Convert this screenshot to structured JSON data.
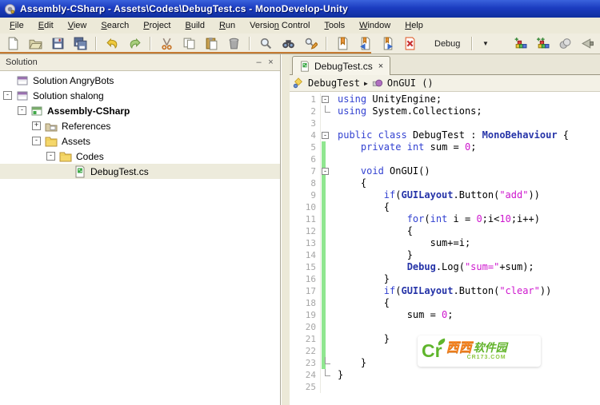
{
  "window": {
    "title": "Assembly-CSharp - Assets\\Codes\\DebugTest.cs - MonoDevelop-Unity"
  },
  "menu": {
    "items": [
      {
        "label": "File",
        "u": 0
      },
      {
        "label": "Edit",
        "u": 0
      },
      {
        "label": "View",
        "u": 0
      },
      {
        "label": "Search",
        "u": 0
      },
      {
        "label": "Project",
        "u": 0
      },
      {
        "label": "Build",
        "u": 0
      },
      {
        "label": "Run",
        "u": 0
      },
      {
        "label": "Version Control",
        "u": 6
      },
      {
        "label": "Tools",
        "u": 0
      },
      {
        "label": "Window",
        "u": 0
      },
      {
        "label": "Help",
        "u": 0
      }
    ]
  },
  "toolbar": {
    "debug_config": "Debug",
    "dropdown_glyph": "▼",
    "icons": [
      "new-file",
      "open",
      "save",
      "save-all",
      "undo",
      "redo",
      "cut",
      "copy",
      "paste",
      "delete",
      "search",
      "find-in-files",
      "search-replace",
      "toggle-bookmark",
      "previous-bookmark",
      "next-bookmark",
      "clear-bookmarks",
      "debug-config-dropdown",
      "unit-tests",
      "add-unit-tests",
      "attach-process",
      "filter"
    ]
  },
  "solution_pad": {
    "title": "Solution",
    "buttons": {
      "minimize": "‒",
      "close": "×"
    },
    "tree": [
      {
        "label": "Solution AngryBots",
        "level": 0,
        "expander": "none",
        "icon": "solution",
        "bold": false,
        "selected": false
      },
      {
        "label": "Solution shalong",
        "level": 0,
        "expander": "minus",
        "icon": "solution",
        "bold": false,
        "selected": false
      },
      {
        "label": "Assembly-CSharp",
        "level": 1,
        "expander": "minus",
        "icon": "project",
        "bold": true,
        "selected": false
      },
      {
        "label": "References",
        "level": 2,
        "expander": "plus",
        "icon": "references",
        "bold": false,
        "selected": false
      },
      {
        "label": "Assets",
        "level": 2,
        "expander": "minus",
        "icon": "folder",
        "bold": false,
        "selected": false
      },
      {
        "label": "Codes",
        "level": 3,
        "expander": "minus",
        "icon": "folder",
        "bold": false,
        "selected": false
      },
      {
        "label": "DebugTest.cs",
        "level": 4,
        "expander": "none",
        "icon": "csfile",
        "bold": false,
        "selected": true
      }
    ]
  },
  "editor": {
    "tab": {
      "label": "DebugTest.cs",
      "close_glyph": "×"
    },
    "breadcrumb": {
      "class_name": "DebugTest",
      "separator": "▶",
      "method": "OnGUI ()"
    },
    "code": {
      "lines": [
        {
          "n": "1",
          "fold": "start",
          "chg": false,
          "segs": [
            [
              "kw",
              "using"
            ],
            [
              "pl",
              " UnityEngine;"
            ]
          ]
        },
        {
          "n": "2",
          "fold": "end",
          "chg": false,
          "segs": [
            [
              "kw",
              "using"
            ],
            [
              "pl",
              " System.Collections;"
            ]
          ]
        },
        {
          "n": "3",
          "fold": "none",
          "chg": false,
          "segs": []
        },
        {
          "n": "4",
          "fold": "start",
          "chg": false,
          "segs": [
            [
              "kw",
              "public"
            ],
            [
              "pl",
              " "
            ],
            [
              "kw",
              "class"
            ],
            [
              "pl",
              " DebugTest : "
            ],
            [
              "ty",
              "MonoBehaviour"
            ],
            [
              "pl",
              " {"
            ]
          ]
        },
        {
          "n": "5",
          "fold": "none",
          "chg": true,
          "segs": [
            [
              "pl",
              "    "
            ],
            [
              "kw",
              "private"
            ],
            [
              "pl",
              " "
            ],
            [
              "kw",
              "int"
            ],
            [
              "pl",
              " sum = "
            ],
            [
              "nu",
              "0"
            ],
            [
              "pl",
              ";"
            ]
          ]
        },
        {
          "n": "6",
          "fold": "none",
          "chg": true,
          "segs": []
        },
        {
          "n": "7",
          "fold": "start",
          "chg": true,
          "segs": [
            [
              "pl",
              "    "
            ],
            [
              "kw",
              "void"
            ],
            [
              "pl",
              " OnGUI()"
            ]
          ]
        },
        {
          "n": "8",
          "fold": "none",
          "chg": true,
          "segs": [
            [
              "pl",
              "    {"
            ]
          ]
        },
        {
          "n": "9",
          "fold": "none",
          "chg": true,
          "segs": [
            [
              "pl",
              "        "
            ],
            [
              "kw",
              "if"
            ],
            [
              "pl",
              "("
            ],
            [
              "ty",
              "GUILayout"
            ],
            [
              "pl",
              ".Button("
            ],
            [
              "st",
              "\"add\""
            ],
            [
              "pl",
              "))"
            ]
          ]
        },
        {
          "n": "10",
          "fold": "none",
          "chg": true,
          "segs": [
            [
              "pl",
              "        {"
            ]
          ]
        },
        {
          "n": "11",
          "fold": "none",
          "chg": true,
          "segs": [
            [
              "pl",
              "            "
            ],
            [
              "kw",
              "for"
            ],
            [
              "pl",
              "("
            ],
            [
              "kw",
              "int"
            ],
            [
              "pl",
              " i = "
            ],
            [
              "nu",
              "0"
            ],
            [
              "pl",
              ";i<"
            ],
            [
              "nu",
              "10"
            ],
            [
              "pl",
              ";i++)"
            ]
          ]
        },
        {
          "n": "12",
          "fold": "none",
          "chg": true,
          "segs": [
            [
              "pl",
              "            {"
            ]
          ]
        },
        {
          "n": "13",
          "fold": "none",
          "chg": true,
          "segs": [
            [
              "pl",
              "                sum+=i;"
            ]
          ]
        },
        {
          "n": "14",
          "fold": "none",
          "chg": true,
          "segs": [
            [
              "pl",
              "            }"
            ]
          ]
        },
        {
          "n": "15",
          "fold": "none",
          "chg": true,
          "segs": [
            [
              "pl",
              "            "
            ],
            [
              "ty",
              "Debug"
            ],
            [
              "pl",
              ".Log("
            ],
            [
              "st",
              "\"sum=\""
            ],
            [
              "pl",
              "+sum);"
            ]
          ]
        },
        {
          "n": "16",
          "fold": "none",
          "chg": true,
          "segs": [
            [
              "pl",
              "        }"
            ]
          ]
        },
        {
          "n": "17",
          "fold": "none",
          "chg": true,
          "segs": [
            [
              "pl",
              "        "
            ],
            [
              "kw",
              "if"
            ],
            [
              "pl",
              "("
            ],
            [
              "ty",
              "GUILayout"
            ],
            [
              "pl",
              ".Button("
            ],
            [
              "st",
              "\"clear\""
            ],
            [
              "pl",
              "))"
            ]
          ]
        },
        {
          "n": "18",
          "fold": "none",
          "chg": true,
          "segs": [
            [
              "pl",
              "        {"
            ]
          ]
        },
        {
          "n": "19",
          "fold": "none",
          "chg": true,
          "segs": [
            [
              "pl",
              "            sum = "
            ],
            [
              "nu",
              "0"
            ],
            [
              "pl",
              ";"
            ]
          ]
        },
        {
          "n": "20",
          "fold": "none",
          "chg": true,
          "segs": []
        },
        {
          "n": "21",
          "fold": "none",
          "chg": true,
          "segs": [
            [
              "pl",
              "        }"
            ]
          ]
        },
        {
          "n": "22",
          "fold": "none",
          "chg": true,
          "segs": []
        },
        {
          "n": "23",
          "fold": "end",
          "chg": true,
          "segs": [
            [
              "pl",
              "    }"
            ]
          ]
        },
        {
          "n": "24",
          "fold": "end",
          "chg": false,
          "segs": [
            [
              "pl",
              "}"
            ]
          ]
        },
        {
          "n": "25",
          "fold": "none",
          "chg": false,
          "segs": []
        }
      ]
    }
  },
  "watermark": {
    "mark": "Cr",
    "title_orange": "西西",
    "title_green": "软件园",
    "domain": "CR173.COM",
    "colors": {
      "green": "#5FB52C",
      "orange": "#F5821F"
    }
  }
}
